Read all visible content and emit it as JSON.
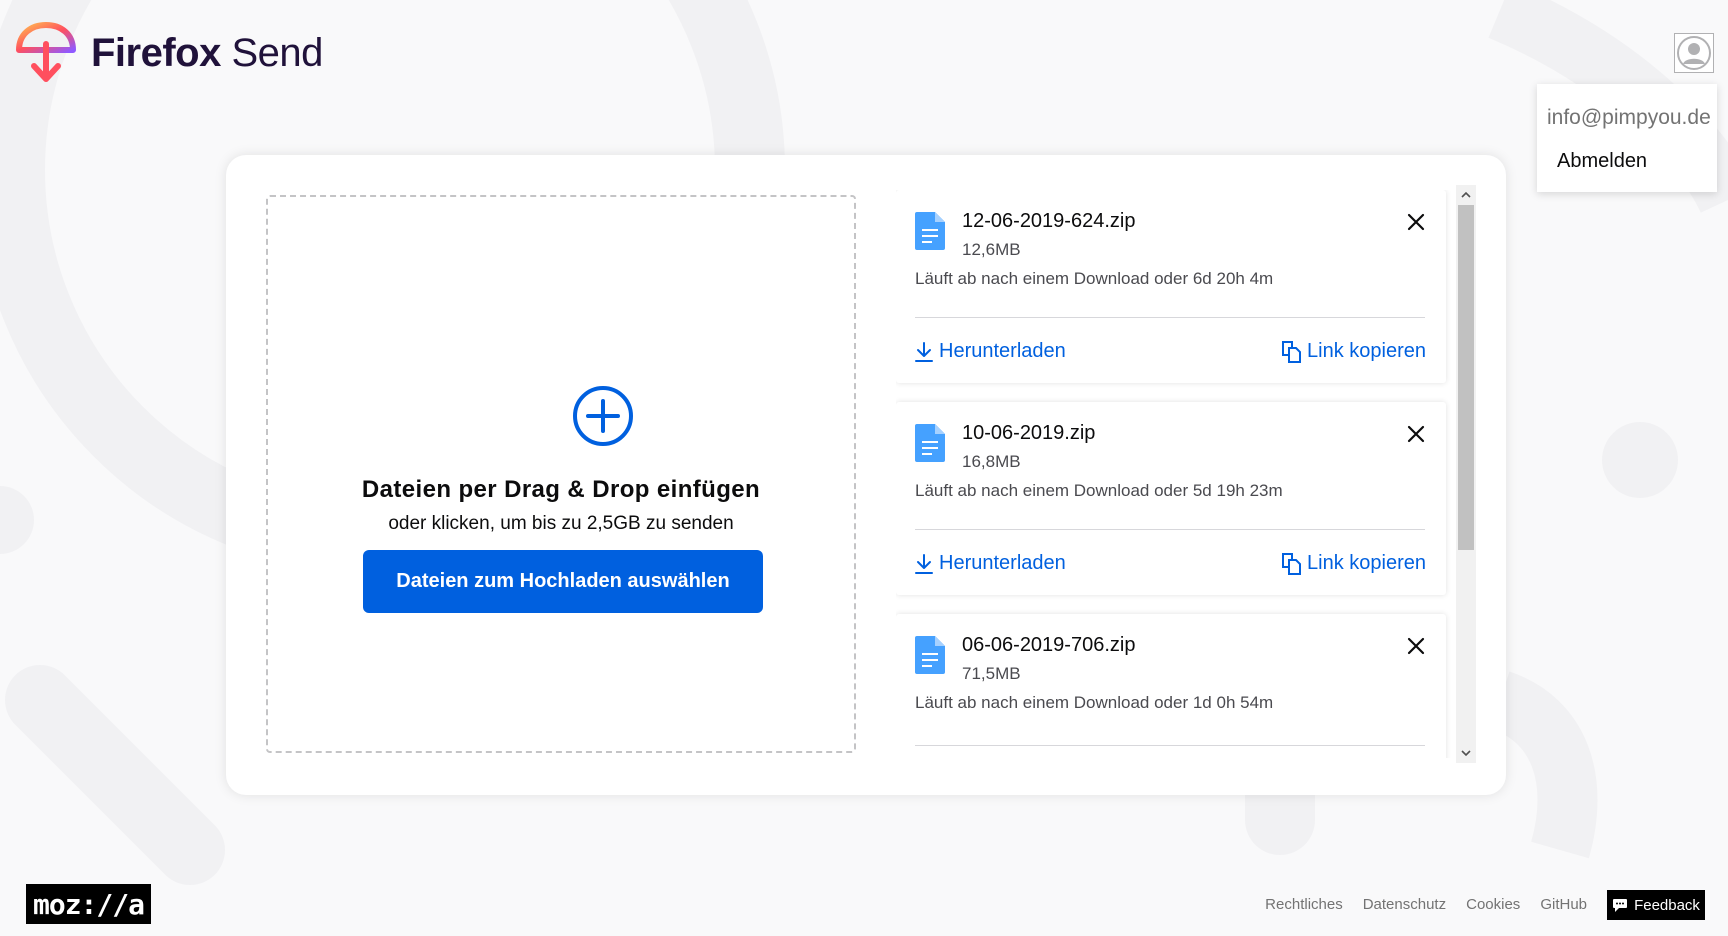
{
  "brand": {
    "name_bold": "Firefox",
    "name_light": " Send"
  },
  "user_menu": {
    "email": "info@pimpyou.de",
    "logout_label": "Abmelden"
  },
  "upload": {
    "title": "Dateien per Drag & Drop einfügen",
    "subtitle": "oder klicken, um bis zu 2,5GB zu senden",
    "button_label": "Dateien zum Hochladen auswählen"
  },
  "files": [
    {
      "name": "12-06-2019-624.zip",
      "size": "12,6MB",
      "expiry": "Läuft ab nach einem Download oder 6d 20h 4m",
      "download_label": "Herunterladen",
      "copy_label": "Link kopieren"
    },
    {
      "name": "10-06-2019.zip",
      "size": "16,8MB",
      "expiry": "Läuft ab nach einem Download oder 5d 19h 23m",
      "download_label": "Herunterladen",
      "copy_label": "Link kopieren"
    },
    {
      "name": "06-06-2019-706.zip",
      "size": "71,5MB",
      "expiry": "Läuft ab nach einem Download oder 1d 0h 54m"
    }
  ],
  "footer": {
    "mozilla_logo": "moz://a",
    "links": [
      "Rechtliches",
      "Datenschutz",
      "Cookies",
      "GitHub"
    ],
    "feedback_label": "Feedback"
  },
  "colors": {
    "accent": "#0060df",
    "background": "#f9f9fa",
    "text": "#0c0c0d",
    "muted": "#737373"
  }
}
